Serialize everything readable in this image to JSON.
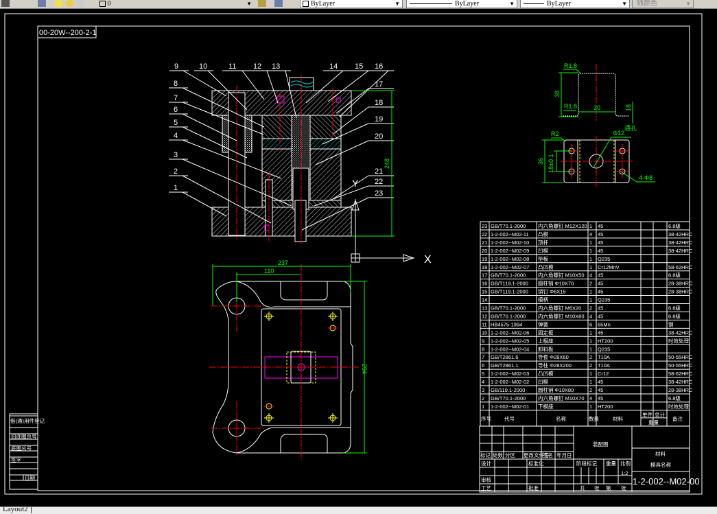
{
  "toolbar": {
    "layer_value": "0",
    "color_value": "ByLayer",
    "linetype_value": "ByLayer",
    "lineweight_value": "ByLayer",
    "plotstyle_value": "随颜色",
    "icons": [
      "layer-manager-icon",
      "lightbulb-icon",
      "sun-icon",
      "lock-icon",
      "layer-previous-icon",
      "layer-match-icon"
    ]
  },
  "drawing": {
    "title_label": "00-20W--200-2-1",
    "section_labels": [
      "1",
      "2",
      "3",
      "4",
      "5",
      "6",
      "7",
      "8",
      "9",
      "10",
      "11",
      "12",
      "13",
      "14",
      "15",
      "16",
      "17",
      "18",
      "19",
      "20",
      "21",
      "22",
      "23"
    ],
    "dim_height": "248",
    "plan_dims": {
      "width": "237",
      "offset": "110",
      "height": "294"
    },
    "part_dims": {
      "r_top": "R1.8",
      "r_bottom": "R1.8",
      "height": "38",
      "width": "30",
      "flange": "18",
      "r_corner": "R2",
      "hole": "Φ12",
      "hole_note": "通孔",
      "blank_h": "36",
      "hole_pitch": "18±0.1",
      "small_holes": "4-Φ8"
    },
    "ucs": {
      "x": "X",
      "y": "Y"
    }
  },
  "parts_table": {
    "headers": [
      "序号",
      "代号",
      "名称",
      "数量",
      "材料",
      "单件",
      "总计",
      "重量",
      "备注"
    ],
    "rows": [
      [
        "23",
        "GB/T70.1-2000",
        "内六角螺钉 M12X120",
        "1",
        "45",
        "6.8级"
      ],
      [
        "22",
        "1-2-002--M02-11",
        "凸模",
        "4",
        "45",
        "38-42HRC"
      ],
      [
        "21",
        "1-2-002--M02-10",
        "顶杆",
        "1",
        "45",
        "38-42HRC"
      ],
      [
        "20",
        "1-2-002--M02-09",
        "凹模",
        "1",
        "45",
        "38-42HRC"
      ],
      [
        "19",
        "1-2-002--M02-08",
        "垫板",
        "1",
        "Q235",
        ""
      ],
      [
        "18",
        "1-2-002--M02-07",
        "凸凹模",
        "1",
        "Cr12MnV",
        "58-62HRC"
      ],
      [
        "17",
        "GB/T70.1-2000",
        "内六角螺钉 M10X50",
        "4",
        "45",
        "6.8级"
      ],
      [
        "16",
        "GB/T119.1-2000",
        "圆柱销 Φ10X70",
        "2",
        "45",
        "28-38HRC"
      ],
      [
        "15",
        "GB/T119.1-2000",
        "销钉 Φ6X15",
        "1",
        "45",
        "28-38HRC"
      ],
      [
        "14",
        "",
        "模柄",
        "1",
        "Q235",
        ""
      ],
      [
        "13",
        "GB/T70.1-2000",
        "内六角螺钉 M6X20",
        "2",
        "45",
        "6.8级"
      ],
      [
        "12",
        "GB/T70.1-2000",
        "内六角螺钉 M10X80",
        "4",
        "45",
        "6.8级"
      ],
      [
        "11",
        "HB4575-1994",
        "弹簧",
        "6",
        "65Mn",
        "钢"
      ],
      [
        "10",
        "1-2-002--M02-06",
        "固定板",
        "1",
        "45",
        "38-42HRC"
      ],
      [
        "9",
        "1-2-002--M02-05",
        "上模座",
        "1",
        "HT200",
        "时效处理"
      ],
      [
        "8",
        "1-2-002--M02-04",
        "卸料板",
        "1",
        "Q235",
        ""
      ],
      [
        "7",
        "GB/T2861.6",
        "导套 Φ28X60",
        "2",
        "T10A",
        "50-55HRC"
      ],
      [
        "6",
        "GB/T2861.1",
        "导柱 Φ28X200",
        "2",
        "T10A",
        "50-55HRC"
      ],
      [
        "5",
        "1-2-002--M02-03",
        "凸凹模",
        "1",
        "Cr12",
        "58-62HRC"
      ],
      [
        "4",
        "1-2-002--M02-02",
        "凹模",
        "1",
        "45",
        "38-42HRC"
      ],
      [
        "3",
        "GB/119.1-2000",
        "圆柱销 Φ10X80",
        "2",
        "45",
        "28-38HRC"
      ],
      [
        "2",
        "GB/T70.1-2000",
        "内六角螺钉 M10X70",
        "4",
        "45",
        "6.8级"
      ],
      [
        "1",
        "1-2-002--M02-01",
        "下模座",
        "1",
        "HT200",
        "时效处理"
      ]
    ]
  },
  "title_block": {
    "drawing_type": "装配图",
    "material_label": "材料",
    "drawing_name": "模具名称",
    "drawing_number": "1-2-002--M02-00",
    "scale": "1:2",
    "rev_headers": [
      "标记",
      "处数",
      "分区",
      "更改文件号",
      "签名",
      "年月日"
    ],
    "row_labels": [
      "设计",
      "标准化",
      "审核",
      "工艺",
      "批准"
    ],
    "stage_headers": [
      "阶段标记",
      "重量",
      "比例"
    ],
    "sheet_text": [
      "共",
      "张",
      "第",
      "张"
    ]
  },
  "left_strip": [
    "借(通)用件登记",
    "旧底图总号",
    "底图总号",
    "签字",
    "日期"
  ],
  "tabs": {
    "layout2": "Layout2"
  }
}
